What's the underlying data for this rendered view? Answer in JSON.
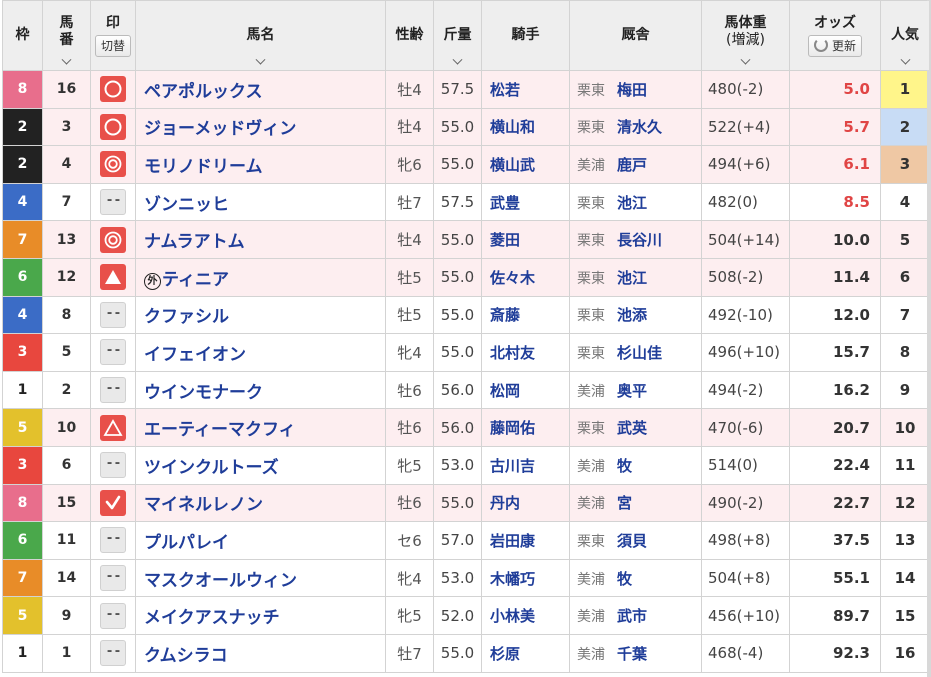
{
  "headers": {
    "waku": "枠",
    "umaban_1": "馬",
    "umaban_2": "番",
    "mark": "印",
    "mark_toggle": "切替",
    "name": "馬名",
    "sexage": "性齢",
    "kinryo": "斤量",
    "jockey": "騎手",
    "stable": "厩舎",
    "weight_1": "馬体重",
    "weight_2": "(増減)",
    "odds": "オッズ",
    "odds_refresh": "更新",
    "pop": "人気"
  },
  "colors": {
    "row_highlight": "#fdeef0",
    "odds_hot": "#e04545",
    "pop1": "#fff58a",
    "pop2": "#c8dcf5",
    "pop3": "#efc8a4"
  },
  "rows": [
    {
      "waku": "8",
      "umaban": "16",
      "mark": "circle-mark",
      "name": "ペアポルックス",
      "foreign": false,
      "sexage": "牡4",
      "kinryo": "57.5",
      "jockey": "松若",
      "loc": "栗東",
      "trainer": "梅田",
      "weight": "480(-2)",
      "odds": "5.0",
      "pop": "1",
      "hot": true,
      "pink": true
    },
    {
      "waku": "2",
      "umaban": "3",
      "mark": "circle-mark",
      "name": "ジョーメッドヴィン",
      "foreign": false,
      "sexage": "牡4",
      "kinryo": "55.0",
      "jockey": "横山和",
      "loc": "栗東",
      "trainer": "清水久",
      "weight": "522(+4)",
      "odds": "5.7",
      "pop": "2",
      "hot": true,
      "pink": true
    },
    {
      "waku": "2",
      "umaban": "4",
      "mark": "double-circle-mark",
      "name": "モリノドリーム",
      "foreign": false,
      "sexage": "牝6",
      "kinryo": "55.0",
      "jockey": "横山武",
      "loc": "美浦",
      "trainer": "鹿戸",
      "weight": "494(+6)",
      "odds": "6.1",
      "pop": "3",
      "hot": true,
      "pink": true
    },
    {
      "waku": "4",
      "umaban": "7",
      "mark": "none",
      "name": "ゾンニッヒ",
      "foreign": false,
      "sexage": "牡7",
      "kinryo": "57.5",
      "jockey": "武豊",
      "loc": "栗東",
      "trainer": "池江",
      "weight": "482(0)",
      "odds": "8.5",
      "pop": "4",
      "hot": true,
      "pink": false
    },
    {
      "waku": "7",
      "umaban": "13",
      "mark": "double-circle-mark",
      "name": "ナムラアトム",
      "foreign": false,
      "sexage": "牡4",
      "kinryo": "55.0",
      "jockey": "菱田",
      "loc": "栗東",
      "trainer": "長谷川",
      "weight": "504(+14)",
      "odds": "10.0",
      "pop": "5",
      "hot": false,
      "pink": true
    },
    {
      "waku": "6",
      "umaban": "12",
      "mark": "triangle-filled-mark",
      "name": "ティニア",
      "foreign": true,
      "foreign_label": "外",
      "sexage": "牡5",
      "kinryo": "55.0",
      "jockey": "佐々木",
      "loc": "栗東",
      "trainer": "池江",
      "weight": "508(-2)",
      "odds": "11.4",
      "pop": "6",
      "hot": false,
      "pink": true
    },
    {
      "waku": "4",
      "umaban": "8",
      "mark": "none",
      "name": "クファシル",
      "foreign": false,
      "sexage": "牡5",
      "kinryo": "55.0",
      "jockey": "斎藤",
      "loc": "栗東",
      "trainer": "池添",
      "weight": "492(-10)",
      "odds": "12.0",
      "pop": "7",
      "hot": false,
      "pink": false
    },
    {
      "waku": "3",
      "umaban": "5",
      "mark": "none",
      "name": "イフェイオン",
      "foreign": false,
      "sexage": "牝4",
      "kinryo": "55.0",
      "jockey": "北村友",
      "loc": "栗東",
      "trainer": "杉山佳",
      "weight": "496(+10)",
      "odds": "15.7",
      "pop": "8",
      "hot": false,
      "pink": false
    },
    {
      "waku": "1",
      "umaban": "2",
      "mark": "none",
      "name": "ウインモナーク",
      "foreign": false,
      "sexage": "牡6",
      "kinryo": "56.0",
      "jockey": "松岡",
      "loc": "美浦",
      "trainer": "奥平",
      "weight": "494(-2)",
      "odds": "16.2",
      "pop": "9",
      "hot": false,
      "pink": false
    },
    {
      "waku": "5",
      "umaban": "10",
      "mark": "triangle-outline-mark",
      "name": "エーティーマクフィ",
      "foreign": false,
      "sexage": "牡6",
      "kinryo": "56.0",
      "jockey": "藤岡佑",
      "loc": "栗東",
      "trainer": "武英",
      "weight": "470(-6)",
      "odds": "20.7",
      "pop": "10",
      "hot": false,
      "pink": true
    },
    {
      "waku": "3",
      "umaban": "6",
      "mark": "none",
      "name": "ツインクルトーズ",
      "foreign": false,
      "sexage": "牝5",
      "kinryo": "53.0",
      "jockey": "古川吉",
      "loc": "美浦",
      "trainer": "牧",
      "weight": "514(0)",
      "odds": "22.4",
      "pop": "11",
      "hot": false,
      "pink": false
    },
    {
      "waku": "8",
      "umaban": "15",
      "mark": "check-mark",
      "name": "マイネルレノン",
      "foreign": false,
      "sexage": "牡6",
      "kinryo": "55.0",
      "jockey": "丹内",
      "loc": "美浦",
      "trainer": "宮",
      "weight": "490(-2)",
      "odds": "22.7",
      "pop": "12",
      "hot": false,
      "pink": true
    },
    {
      "waku": "6",
      "umaban": "11",
      "mark": "none",
      "name": "プルパレイ",
      "foreign": false,
      "sexage": "セ6",
      "kinryo": "57.0",
      "jockey": "岩田康",
      "loc": "栗東",
      "trainer": "須貝",
      "weight": "498(+8)",
      "odds": "37.5",
      "pop": "13",
      "hot": false,
      "pink": false
    },
    {
      "waku": "7",
      "umaban": "14",
      "mark": "none",
      "name": "マスクオールウィン",
      "foreign": false,
      "sexage": "牝4",
      "kinryo": "53.0",
      "jockey": "木幡巧",
      "loc": "美浦",
      "trainer": "牧",
      "weight": "504(+8)",
      "odds": "55.1",
      "pop": "14",
      "hot": false,
      "pink": false
    },
    {
      "waku": "5",
      "umaban": "9",
      "mark": "none",
      "name": "メイクアスナッチ",
      "foreign": false,
      "sexage": "牝5",
      "kinryo": "52.0",
      "jockey": "小林美",
      "loc": "美浦",
      "trainer": "武市",
      "weight": "456(+10)",
      "odds": "89.7",
      "pop": "15",
      "hot": false,
      "pink": false
    },
    {
      "waku": "1",
      "umaban": "1",
      "mark": "none",
      "name": "クムシラコ",
      "foreign": false,
      "sexage": "牡7",
      "kinryo": "55.0",
      "jockey": "杉原",
      "loc": "美浦",
      "trainer": "千葉",
      "weight": "468(-4)",
      "odds": "92.3",
      "pop": "16",
      "hot": false,
      "pink": false
    }
  ]
}
